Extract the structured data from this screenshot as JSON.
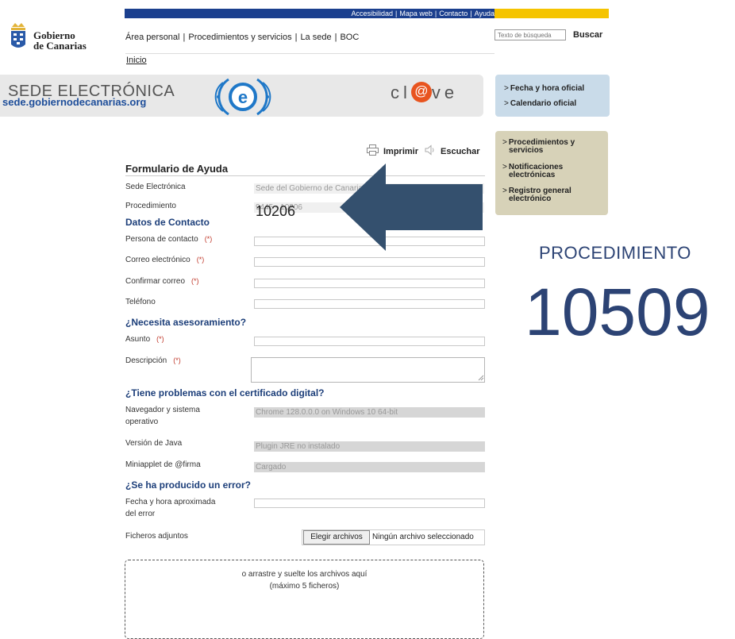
{
  "topbar": {
    "links": [
      "Accesibilidad",
      "Mapa web",
      "Contacto",
      "Ayuda"
    ],
    "bar_color": "#1b3f8e",
    "accent_color": "#f5c400"
  },
  "logo": {
    "line1": "Gobierno",
    "line2": "de Canarias"
  },
  "nav": {
    "items": [
      "Área personal",
      "Procedimientos y servicios",
      "La sede",
      "BOC"
    ],
    "breadcrumb": "Inicio"
  },
  "search": {
    "placeholder": "Texto de búsqueda",
    "button": "Buscar"
  },
  "banner": {
    "title": "SEDE ELECTRÓNICA",
    "url": "sede.gobiernodecanarias.org",
    "clave_left": "cl",
    "clave_at": "@",
    "clave_right": "ve"
  },
  "right_box_1": {
    "links": [
      "Fecha y hora oficial",
      "Calendario oficial"
    ],
    "color": "#c9dbe9"
  },
  "right_box_2": {
    "links": [
      [
        "Procedimientos y",
        "servicios"
      ],
      [
        "Notificaciones",
        "electrónicas"
      ],
      [
        "Registro general",
        "electrónico"
      ]
    ],
    "color": "#d7d2b8"
  },
  "tools": {
    "print": "Imprimir",
    "listen": "Escuchar"
  },
  "form": {
    "title": "Formulario de Ayuda",
    "sede_label": "Sede Electrónica",
    "sede_value": "Sede del Gobierno de Canarias",
    "procedimiento_label": "Procedimiento",
    "procedimiento_value": "9445 - 10206",
    "contact_section": "Datos de Contacto",
    "contact_person": "Persona de contacto",
    "email": "Correo electrónico",
    "confirm_email": "Confirmar correo",
    "phone": "Teléfono",
    "required_mark": "(*)",
    "advice_section": "¿Necesita asesoramiento?",
    "subject": "Asunto",
    "description": "Descripción",
    "cert_section": "¿Tiene problemas con el certificado digital?",
    "browser_label_1": "Navegador y sistema",
    "browser_label_2": "operativo",
    "browser_value": "Chrome 128.0.0.0 on Windows 10 64-bit",
    "java_label": "Versión de Java",
    "java_value": "Plugin JRE no instalado",
    "applet_label": "Miniapplet de @firma",
    "applet_value": "Cargado",
    "error_section": "¿Se ha producido un error?",
    "date_label_1": "Fecha y hora aproximada",
    "date_label_2": "del error",
    "files_label": "Ficheros adjuntos",
    "files_button": "Elegir archivos",
    "files_status": "Ningún archivo seleccionado",
    "drop_line1": "o arrastre y suelte los archivos aquí",
    "drop_line2": "(máximo 5 ficheros)"
  },
  "overlay": {
    "field_number": "10206",
    "label": "PROCEDIMIENTO",
    "number": "10509",
    "arrow_color": "#34506e",
    "text_color": "#2c4374"
  }
}
